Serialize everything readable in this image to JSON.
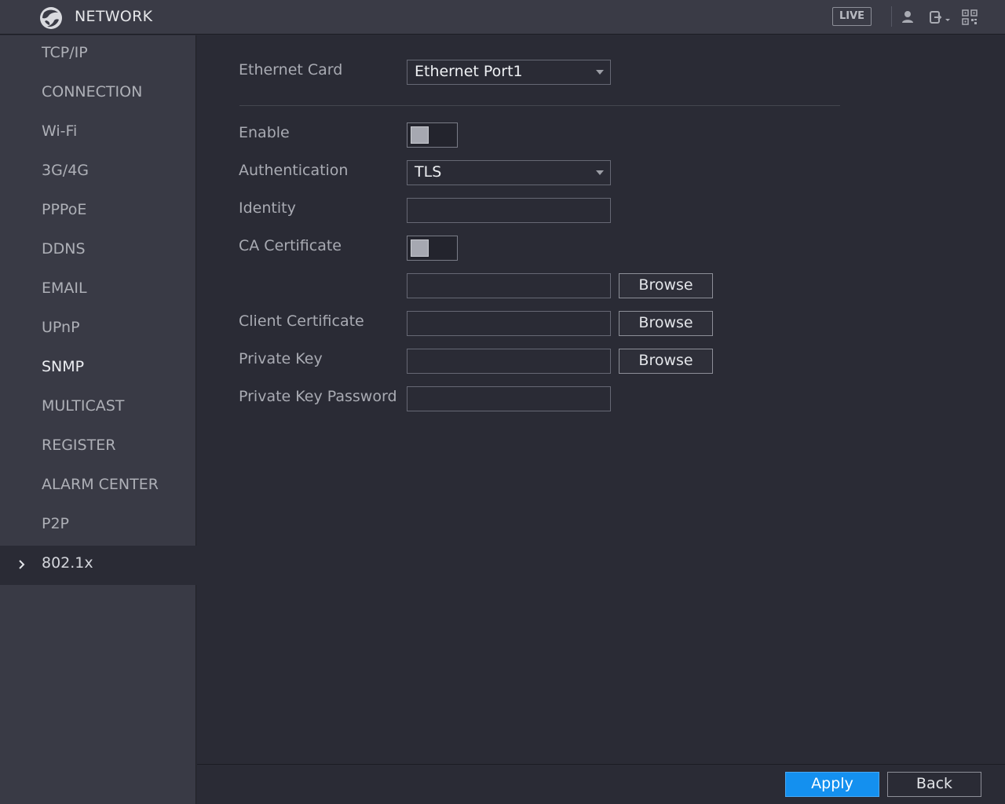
{
  "header": {
    "title": "NETWORK",
    "live_label": "LIVE",
    "icons": [
      "logo-globe-icon",
      "user-icon",
      "logout-icon",
      "qr-code-icon"
    ]
  },
  "sidebar": {
    "items": [
      {
        "label": "TCP/IP"
      },
      {
        "label": "CONNECTION"
      },
      {
        "label": "Wi-Fi"
      },
      {
        "label": "3G/4G"
      },
      {
        "label": "PPPoE"
      },
      {
        "label": "DDNS"
      },
      {
        "label": "EMAIL"
      },
      {
        "label": "UPnP"
      },
      {
        "label": "SNMP"
      },
      {
        "label": "MULTICAST"
      },
      {
        "label": "REGISTER"
      },
      {
        "label": "ALARM CENTER"
      },
      {
        "label": "P2P"
      },
      {
        "label": "802.1x",
        "active": true
      }
    ]
  },
  "form": {
    "ethernet_card": {
      "label": "Ethernet Card",
      "value": "Ethernet Port1"
    },
    "enable": {
      "label": "Enable",
      "state": "off"
    },
    "authentication": {
      "label": "Authentication",
      "value": "TLS"
    },
    "identity": {
      "label": "Identity",
      "value": ""
    },
    "ca_certificate": {
      "label": "CA Certificate",
      "state": "off",
      "path": "",
      "browse_label": "Browse"
    },
    "client_certificate": {
      "label": "Client Certificate",
      "path": "",
      "browse_label": "Browse"
    },
    "private_key": {
      "label": "Private Key",
      "path": "",
      "browse_label": "Browse"
    },
    "private_key_password": {
      "label": "Private Key Password",
      "value": ""
    }
  },
  "footer": {
    "apply_label": "Apply",
    "back_label": "Back"
  },
  "colors": {
    "accent": "#1490ef",
    "background": "#2a2b35",
    "sidebar": "#393a45"
  }
}
